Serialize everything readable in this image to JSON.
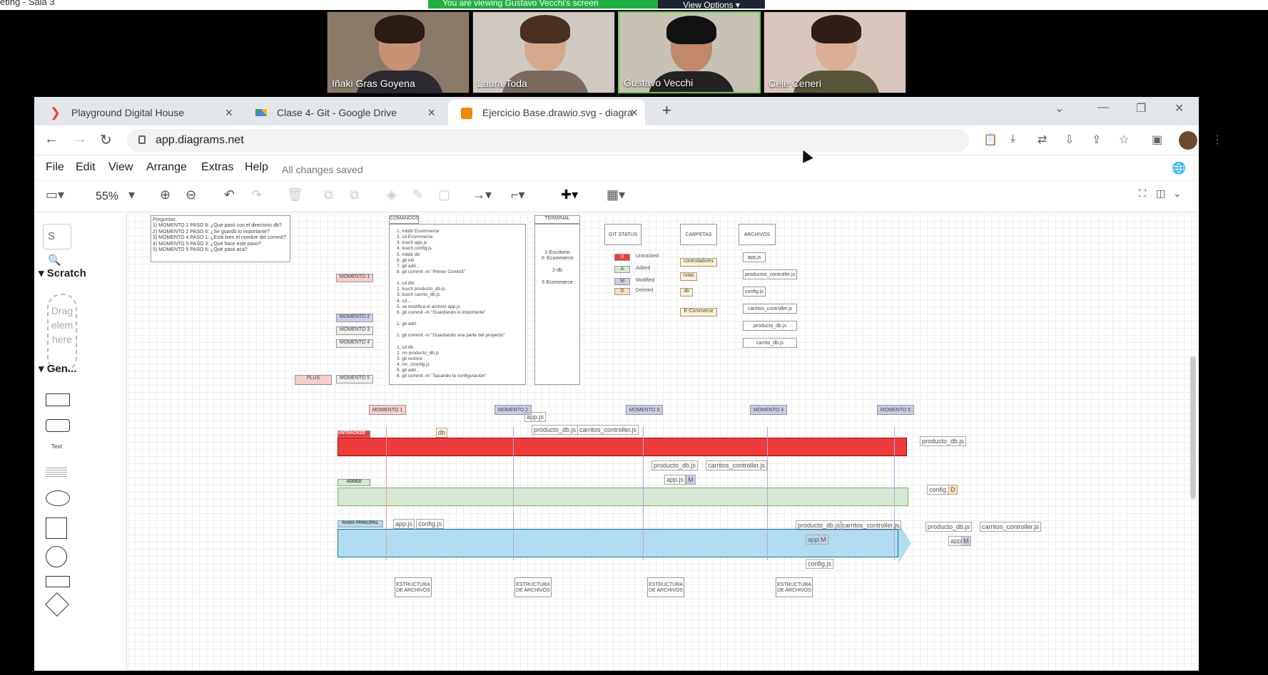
{
  "meeting": {
    "title": "eting - Sala 3",
    "banner": "You are viewing Gustavo Vecchi's screen",
    "view_options": "View Options ▾"
  },
  "participants": [
    "Iñaki Gras Goyena",
    "Laura Toda",
    "Gustavo Vecchi",
    "Cele Ceneri"
  ],
  "browser": {
    "tabs": [
      {
        "label": "Playground Digital House",
        "color": "#e8453c"
      },
      {
        "label": "Clase 4- Git - Google Drive",
        "color": "#34a853"
      },
      {
        "label": "Ejercicio Base.drawio.svg - diagra",
        "color": "#f08705"
      }
    ],
    "url": "app.diagrams.net"
  },
  "app": {
    "menus": [
      "File",
      "Edit",
      "View",
      "Arrange",
      "Extras",
      "Help"
    ],
    "saved": "All changes saved",
    "zoom": "55%",
    "search_placeholder": "S",
    "sections": [
      "Scratch",
      "Gen..."
    ],
    "drag_text": "Drag elem here",
    "shape_text": "Text"
  },
  "diagram": {
    "preguntas": "Preguntas\n1) MOMENTO 1 PASO 8: ¿Qué pasó con el directorio db?\n2) MOMENTO 2 PASO 6: ¿Se guardó lo importante?\n3) MOMENTO 4 PASO 1: ¿Está bien el nombre del commit?\n4) MOMENTO 5 PASO 3: ¿Qué hace este paso?\n5) MOMENTO 5 PASO 6: ¿Qué pasó acá?",
    "comandos_title": "COMANDOS",
    "comandos": "1. mkdir Ecommerce\n2. cd Ecommerce\n3. touch app.js\n4. touch config.js\n5. mkdir db\n6. git init\n7. git add .\n8. git commit -m \"Primer Commit\"\n\n1. cd db/\n2. touch producto_db.js\n3. touch carrito_db.js\n4. cd ..\n5. se modifica el archivo app.js\n6. git commit -m \"Guardando lo importante\"\n\n1. git add .\n\n1. git commit -m \"Guardando una parte del proyecto\"\n\n1. cd db\n2. rm producto_db.js\n3. git restore .\n4. rm ../config.js\n5. git add .\n6. git commit -m \"Sacando la configuración\"",
    "terminal_title": "TERMINAL",
    "terminal": "1-Escritorio\n3- Ecommerce\n\n2-db\n\n5 Ecommerce",
    "git_status_title": "GIT STATUS",
    "status": [
      {
        "code": "U",
        "label": "Untracked",
        "color": "#ee3b3b"
      },
      {
        "code": "A",
        "label": "Added",
        "color": "#d5e8d4"
      },
      {
        "code": "M",
        "label": "Modified",
        "color": "#c9cde8"
      },
      {
        "code": "D",
        "label": "Deleted",
        "color": "#ffe0b3"
      }
    ],
    "carpetas_title": "CARPETAS",
    "carpetas": [
      "controladores",
      "rutas",
      "db",
      "E-Commerce"
    ],
    "archivos_title": "ARCHIVOS",
    "archivos": [
      "app.js",
      "productos_controller.js",
      "config.js",
      "carritos_controller.js",
      "producto_db.js",
      "carrito_db.js"
    ],
    "momentos": [
      "MOMENTO 1",
      "MOMENTO 2",
      "MOMENTO 3",
      "MOMENTO 4",
      "MOMENTO 5"
    ],
    "plus": "PLUS",
    "lanes": [
      "UNTRACKED",
      "ADDED",
      "RAMA PRINCIPAL"
    ],
    "estructura": "ESTRUCTURA DE ARCHIVOS",
    "files": {
      "app": "app.js",
      "config": "config.js",
      "db": "db",
      "producto": "producto_db.js",
      "carritos": "carritos_controller.js",
      "m": "M",
      "d": "D"
    }
  }
}
